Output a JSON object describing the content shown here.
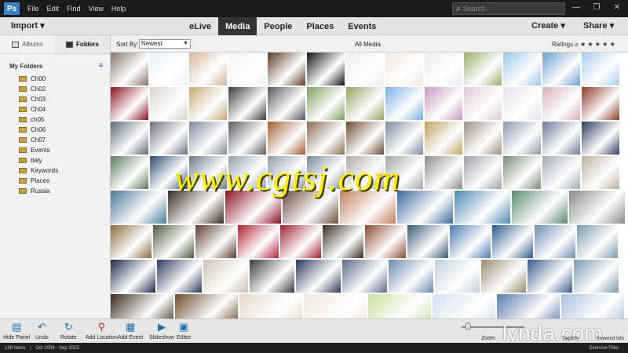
{
  "menubar": {
    "logo": "Ps",
    "items": [
      "File",
      "Edit",
      "Find",
      "View",
      "Help"
    ],
    "search_placeholder": "Search"
  },
  "topbar": {
    "import_label": "Import",
    "tabs": [
      "eLive",
      "Media",
      "People",
      "Places",
      "Events"
    ],
    "active_tab": "Media",
    "create_label": "Create",
    "share_label": "Share"
  },
  "sidebar": {
    "albums_label": "Albums",
    "folders_label": "Folders",
    "my_folders_label": "My Folders",
    "folders": [
      "Ch00",
      "Ch02",
      "Ch03",
      "Ch04",
      "ch05",
      "Ch06",
      "Ch07",
      "Events",
      "Italy",
      "Keywords",
      "Places",
      "Russia"
    ]
  },
  "subbar": {
    "sort_label": "Sort By:",
    "sort_value": "Newest",
    "view_label": "All Media",
    "ratings_label": "Ratings",
    "ratings_op": "≥",
    "stars": "★ ★ ★ ★ ★"
  },
  "watermark": "www.cgtsj.com",
  "grid": {
    "rows": [
      [
        "#8a7468",
        "#e8f0f5",
        "#d5b59a",
        "#f2f2f2",
        "#5a3a22",
        "#111111",
        "#eeeeee",
        "#f2e8dc",
        "#f0eaea",
        "#98b06a",
        "#9ac6e6",
        "#6c9cd0",
        "#aaccec"
      ],
      [
        "#8a1420",
        "#d8d4cc",
        "#c6a874",
        "#3a3a36",
        "#555560",
        "#7aa05a",
        "#9aa060",
        "#7ab0e0",
        "#c698c0",
        "#e0c8d8",
        "#e8e0ea",
        "#d8b0b8",
        "#8a3a28"
      ],
      [
        "#5a6a7a",
        "#6a7080",
        "#7a8a9a",
        "#5a5a60",
        "#a05a30",
        "#8a6a50",
        "#6a4a30",
        "#7a8aa0",
        "#c0a060",
        "#a09080",
        "#8a9ab0",
        "#6a7a9a",
        "#2a3a60"
      ],
      [
        "#5a7a5a",
        "#2a4a70",
        "#6a7a8a",
        "#90a0b0",
        "#8a9aaa",
        "#7a8a9a",
        "#b0a8a0",
        "#a0a4a8",
        "#8a8a8a",
        "#9aa0a8",
        "#7a8a70",
        "#a0aab8",
        "#c0b0a0"
      ],
      [
        "#4a7a9a",
        "#3a2a20",
        "#8a1020",
        "#6a4a3a",
        "#c08060",
        "#3a6a9a",
        "#4a8ab0",
        "#5a8a70",
        "#888a8a"
      ],
      [
        "#8a6a3a",
        "#4a5a3a",
        "#5a3a2a",
        "#b02030",
        "#a02030",
        "#3a2a20",
        "#8a4a30",
        "#3a5a7a",
        "#4a7ab0",
        "#2a5a8a",
        "#6a8ab0",
        "#7a9ab0"
      ],
      [
        "#1a2a4a",
        "#2a3a5a",
        "#d0c0b0",
        "#3a3a3a",
        "#2a3a5a",
        "#5a6a8a",
        "#6a8ab0",
        "#c0d0e0",
        "#9a8a70",
        "#3a5a8a",
        "#7a9ab0"
      ],
      [
        "#3a2a1a",
        "#6a4a2a",
        "#e8d8c8",
        "#f0e8d8",
        "#c8e0a0",
        "#d0e0f0",
        "#5a7ab0",
        "#aac0e0"
      ]
    ]
  },
  "bottombar": {
    "tools": [
      "Hide Panel",
      "Undo",
      "Rotate",
      "Add Location",
      "Add Event",
      "Slideshow",
      "Editor"
    ],
    "zoom_label": "Zoom",
    "lynda": "lynda.com",
    "keyword_label": "Tag/Info",
    "keyword_label2": "Keyword Info"
  },
  "statusbar": {
    "count": "138 Items",
    "range": "Oct 2006 - Sep 2015",
    "right": "Exercise Files"
  }
}
